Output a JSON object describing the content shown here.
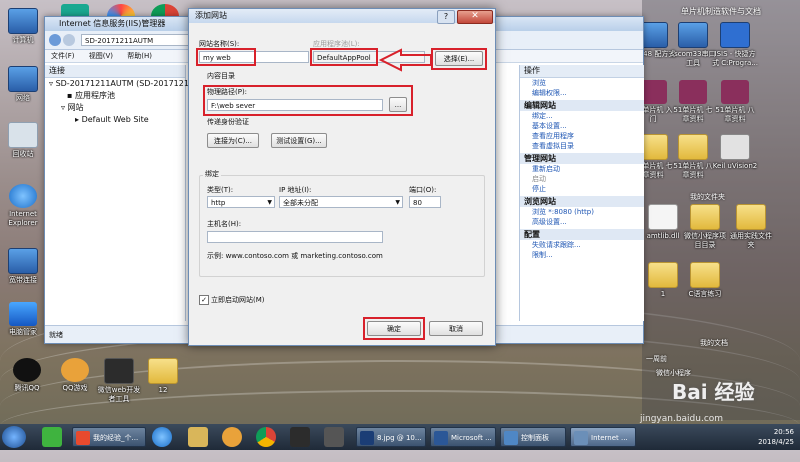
{
  "desktop": {
    "left_icons": [
      {
        "label": "计算机"
      },
      {
        "label": "网络"
      },
      {
        "label": "回收站"
      },
      {
        "label": "Internet Explorer"
      },
      {
        "label": "宽带连接"
      },
      {
        "label": "电脑管家"
      }
    ],
    "bottom_icons": [
      {
        "label": "腾讯QQ"
      },
      {
        "label": "QQ游戏"
      },
      {
        "label": "微信web开发者工具"
      },
      {
        "label": "12"
      }
    ],
    "top_icons": [
      {
        "label": ""
      },
      {
        "label": ""
      },
      {
        "label": ""
      }
    ],
    "right_icons": [
      {
        "label": "单片机制造软件与文档"
      },
      {
        "label": "P_V48 配方式"
      },
      {
        "label": "sscom33串口工具"
      },
      {
        "label": "ISIS - 快捷方式 C:Progra..."
      },
      {
        "label": "51单片机 入门"
      },
      {
        "label": "51单片机 七章资料"
      },
      {
        "label": "51单片机 八章资料"
      },
      {
        "label": "51单片机 七章资料"
      },
      {
        "label": "51单片机 八章资料"
      },
      {
        "label": "Keil uVision2"
      },
      {
        "label": "我的文件夹"
      },
      {
        "label": "amtlib.dll"
      },
      {
        "label": "微信小程序项目目录"
      },
      {
        "label": "通用实践文件夹"
      },
      {
        "label": "1"
      },
      {
        "label": "C语言练习"
      },
      {
        "label": "我的文档"
      },
      {
        "label": "一周前"
      },
      {
        "label": "微信小程序"
      }
    ],
    "watermark": "jingyan.baidu.com",
    "watermark_logo": "Bai 经验"
  },
  "iis": {
    "title": "Internet 信息服务(IIS)管理器",
    "address": "SD-20171211AUTM",
    "menu": [
      "文件(F)",
      "视图(V)",
      "帮助(H)"
    ],
    "connections_header": "连接",
    "tree": [
      "SD-20171211AUTM (SD-20171211AUTM",
      "应用程序池",
      "网站",
      "Default Web Site"
    ],
    "actions_header": "操作",
    "actions": [
      {
        "type": "item",
        "label": "浏览"
      },
      {
        "type": "item",
        "label": "编辑权限..."
      },
      {
        "type": "section",
        "label": "编辑网站"
      },
      {
        "type": "item",
        "label": "绑定..."
      },
      {
        "type": "item",
        "label": "基本设置..."
      },
      {
        "type": "item",
        "label": "查看应用程序"
      },
      {
        "type": "item",
        "label": "查看虚拟目录"
      },
      {
        "type": "section",
        "label": "管理网站"
      },
      {
        "type": "item",
        "label": "重新启动"
      },
      {
        "type": "item-dis",
        "label": "启动"
      },
      {
        "type": "item",
        "label": "停止"
      },
      {
        "type": "section",
        "label": "浏览网站"
      },
      {
        "type": "item",
        "label": "浏览 *:8080 (http)"
      },
      {
        "type": "item",
        "label": "高级设置..."
      },
      {
        "type": "section",
        "label": "配置"
      },
      {
        "type": "item",
        "label": "失败请求跟踪..."
      },
      {
        "type": "item",
        "label": "限制..."
      }
    ],
    "status": "就绪"
  },
  "dialog": {
    "title": "添加网站",
    "help": "?",
    "close": "✕",
    "site_name_label": "网站名称(S):",
    "site_name_value": "my web",
    "app_pool_label": "应用程序池(L):",
    "app_pool_value": "DefaultAppPool",
    "select_button": "选择(E)...",
    "content_dir_title": "内容目录",
    "physical_path_label": "物理路径(P):",
    "physical_path_value": "F:\\web sever",
    "browse_button": "...",
    "pass_auth_label": "传递身份验证",
    "connect_as_button": "连接为(C)...",
    "test_settings_button": "测试设置(G)...",
    "binding_title": "绑定",
    "type_label": "类型(T):",
    "type_value": "http",
    "ip_label": "IP 地址(I):",
    "ip_value": "全部未分配",
    "port_label": "端口(O):",
    "port_value": "80",
    "host_label": "主机名(H):",
    "host_value": "",
    "example_text": "示例: www.contoso.com 或 marketing.contoso.com",
    "start_now_label": "立即启动网站(M)",
    "start_now_checked": true,
    "ok_button": "确定",
    "cancel_button": "取消"
  },
  "taskbar": {
    "items": [
      {
        "label": "我的经验_个..."
      },
      {
        "label": ""
      },
      {
        "label": ""
      },
      {
        "label": ""
      },
      {
        "label": "8.jpg @ 10..."
      },
      {
        "label": "Microsoft ..."
      },
      {
        "label": "控制面板"
      },
      {
        "label": "Internet ..."
      }
    ],
    "time": "20:56",
    "date": "2018/4/25"
  },
  "colors": {
    "highlight": "#d8212b",
    "link": "#1d55b3"
  }
}
